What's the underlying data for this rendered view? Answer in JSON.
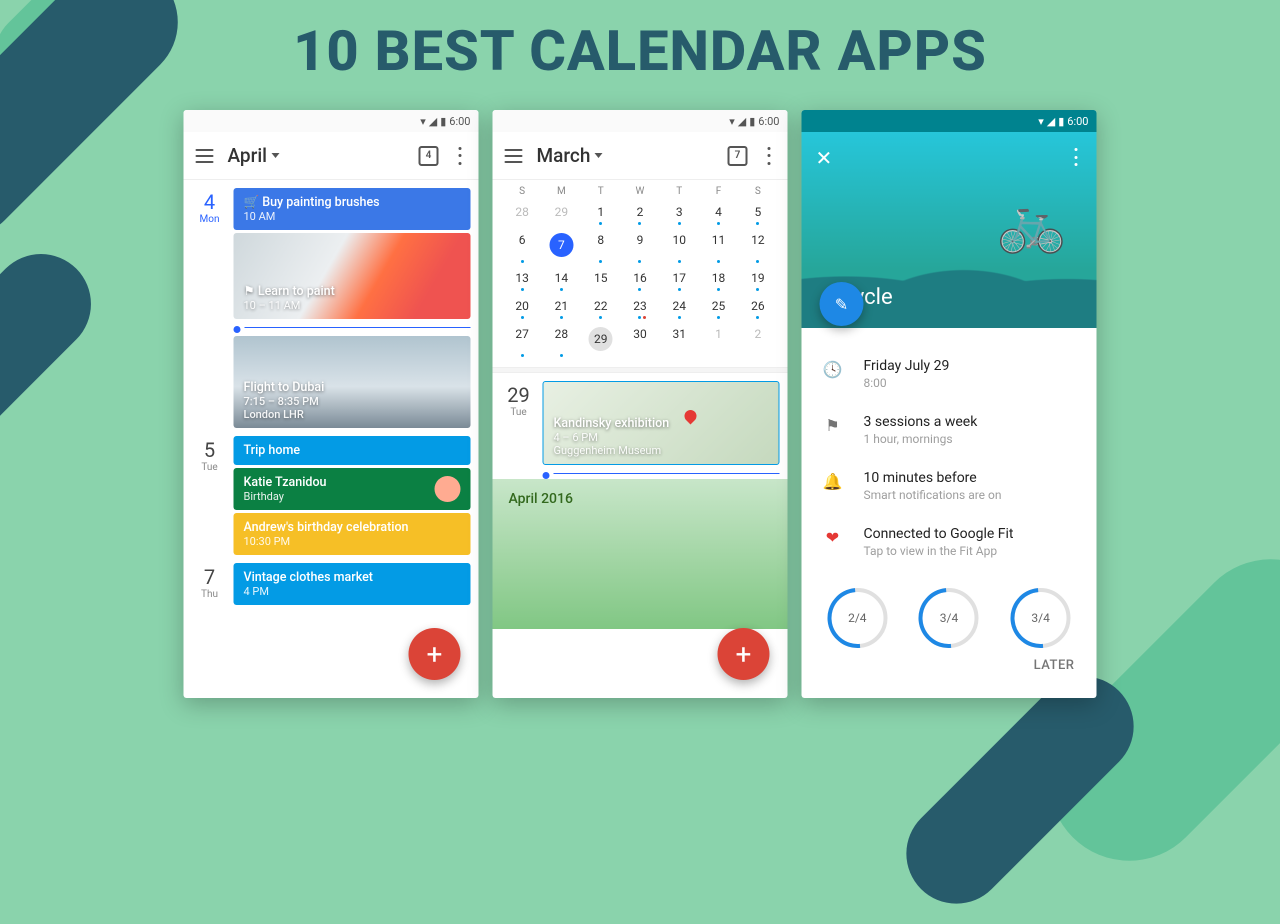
{
  "headline": "10 BEST CALENDAR APPS",
  "status": {
    "time": "6:00"
  },
  "phone1": {
    "month": "April",
    "today_icon_num": "4",
    "days": [
      {
        "num": "4",
        "name": "Mon",
        "events": [
          {
            "kind": "blue",
            "icon": "cart",
            "title": "Buy painting brushes",
            "time": "10 AM"
          },
          {
            "kind": "paint",
            "icon": "flag",
            "title": "Learn to paint",
            "time": "10 – 11 AM"
          },
          {
            "kind": "dubai",
            "title": "Flight to Dubai",
            "time": "7:15 – 8:35 PM",
            "loc": "London LHR"
          }
        ]
      },
      {
        "num": "5",
        "name": "Tue",
        "events": [
          {
            "kind": "teal",
            "title": "Trip home",
            "time": ""
          },
          {
            "kind": "green",
            "title": "Katie Tzanidou",
            "time": "Birthday"
          },
          {
            "kind": "yellow",
            "title": "Andrew's birthday celebration",
            "time": "10:30 PM"
          }
        ]
      },
      {
        "num": "7",
        "name": "Thu",
        "events": [
          {
            "kind": "teal",
            "title": "Vintage clothes market",
            "time": "4 PM"
          }
        ]
      }
    ]
  },
  "phone2": {
    "month": "March",
    "today_icon_num": "7",
    "week_hdr": [
      "S",
      "M",
      "T",
      "W",
      "T",
      "F",
      "S"
    ],
    "grid": [
      [
        {
          "n": "28",
          "m": 1
        },
        {
          "n": "29",
          "m": 1
        },
        {
          "n": "1",
          "d": 1
        },
        {
          "n": "2",
          "d": 1
        },
        {
          "n": "3",
          "d": 1
        },
        {
          "n": "4",
          "d": 1
        },
        {
          "n": "5",
          "d": 1
        }
      ],
      [
        {
          "n": "6",
          "d": 1
        },
        {
          "n": "7",
          "sel": 1
        },
        {
          "n": "8",
          "d": 1
        },
        {
          "n": "9",
          "d": 1
        },
        {
          "n": "10",
          "d": 1
        },
        {
          "n": "11",
          "d": 1
        },
        {
          "n": "12",
          "d": 1
        }
      ],
      [
        {
          "n": "13",
          "d": 1
        },
        {
          "n": "14",
          "d": 1
        },
        {
          "n": "15"
        },
        {
          "n": "16",
          "d": 1
        },
        {
          "n": "17",
          "d": 1
        },
        {
          "n": "18",
          "d": 1
        },
        {
          "n": "19",
          "d": 1
        }
      ],
      [
        {
          "n": "20",
          "d": 1
        },
        {
          "n": "21",
          "d": 1
        },
        {
          "n": "22",
          "d": 1
        },
        {
          "n": "23",
          "d": 1,
          "r": 1
        },
        {
          "n": "24",
          "d": 1
        },
        {
          "n": "25",
          "d": 1
        },
        {
          "n": "26",
          "d": 1
        }
      ],
      [
        {
          "n": "27",
          "d": 1
        },
        {
          "n": "28",
          "d": 1
        },
        {
          "n": "29",
          "c": 1
        },
        {
          "n": "30"
        },
        {
          "n": "31"
        },
        {
          "n": "1",
          "m": 1
        },
        {
          "n": "2",
          "m": 1
        }
      ]
    ],
    "agenda": {
      "num": "29",
      "name": "Tue",
      "event": {
        "title": "Kandinsky exhibition",
        "time": "4 – 6 PM",
        "loc": "Guggenheim Museum"
      }
    },
    "nextmonth": "April 2016"
  },
  "phone3": {
    "title": "Cycle",
    "items": [
      {
        "icon": "clock",
        "main": "Friday July 29",
        "sub": "8:00"
      },
      {
        "icon": "flag",
        "main": "3 sessions a week",
        "sub": "1 hour, mornings"
      },
      {
        "icon": "bell",
        "main": "10 minutes before",
        "sub": "Smart notifications are on"
      },
      {
        "icon": "heart",
        "main": "Connected to Google Fit",
        "sub": "Tap to view in the Fit App"
      }
    ],
    "rings": [
      "2/4",
      "3/4",
      "3/4"
    ],
    "later": "LATER"
  }
}
